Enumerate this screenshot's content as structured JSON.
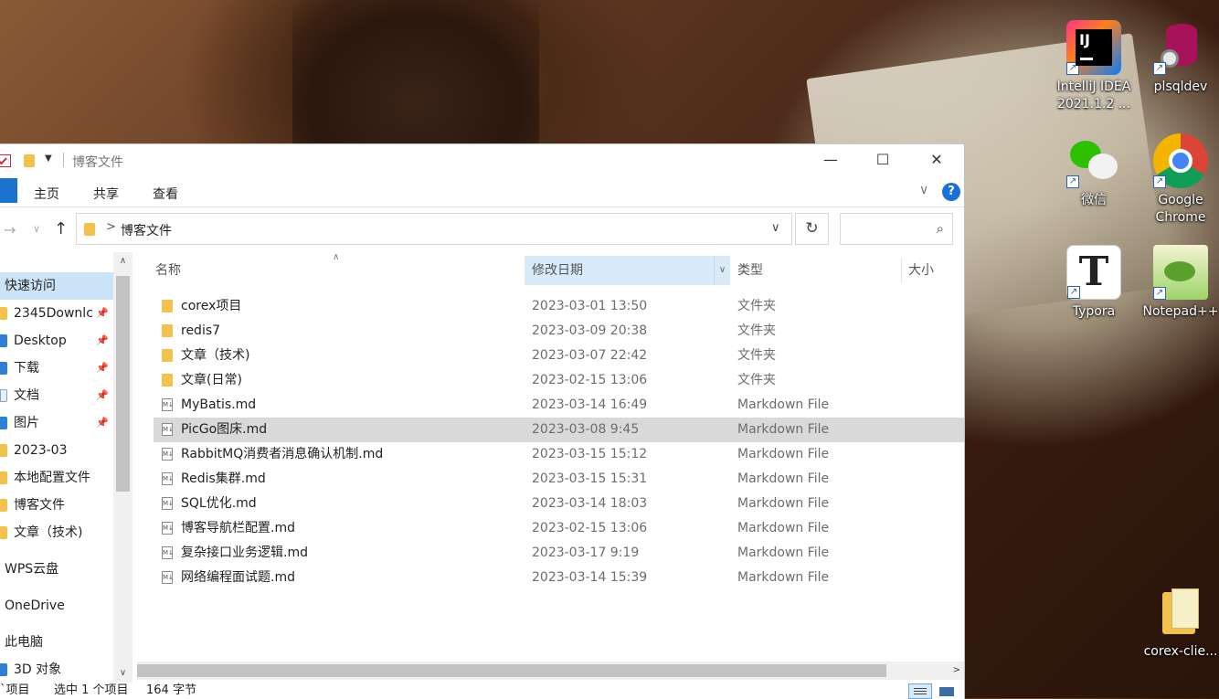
{
  "window": {
    "title": "博客文件",
    "min_glyph": "—",
    "max_glyph": "☐",
    "close_glyph": "✕"
  },
  "ribbon": {
    "tabs": [
      "主页",
      "共享",
      "查看"
    ],
    "help_glyph": "?"
  },
  "address": {
    "path": "博客文件",
    "separator": ">"
  },
  "search": {
    "placeholder": ""
  },
  "navigation": {
    "items": [
      {
        "label": "快速访问",
        "selected": true,
        "pinned": false,
        "icon": "star-icon"
      },
      {
        "label": "2345Downlc",
        "pinned": true,
        "icon": "folder-icon"
      },
      {
        "label": "Desktop",
        "pinned": true,
        "icon": "desktop-icon"
      },
      {
        "label": "下载",
        "pinned": true,
        "icon": "download-icon"
      },
      {
        "label": "文档",
        "pinned": true,
        "icon": "document-icon"
      },
      {
        "label": "图片",
        "pinned": true,
        "icon": "picture-icon"
      },
      {
        "label": "2023-03",
        "pinned": false,
        "icon": "folder-icon"
      },
      {
        "label": "本地配置文件",
        "pinned": false,
        "icon": "folder-icon"
      },
      {
        "label": "博客文件",
        "pinned": false,
        "icon": "folder-icon"
      },
      {
        "label": "文章（技术)",
        "pinned": false,
        "icon": "folder-icon"
      },
      {
        "label": "WPS云盘",
        "pinned": false,
        "icon": "cloud-icon"
      },
      {
        "label": "OneDrive",
        "pinned": false,
        "icon": "onedrive-icon"
      },
      {
        "label": "此电脑",
        "pinned": false,
        "icon": "computer-icon"
      },
      {
        "label": "3D 对象",
        "pinned": false,
        "icon": "3d-objects-icon"
      }
    ]
  },
  "columns": {
    "name": "名称",
    "date": "修改日期",
    "type": "类型",
    "size": "大小"
  },
  "files": [
    {
      "name": "corex项目",
      "date": "2023-03-01 13:50",
      "type": "文件夹",
      "kind": "folder"
    },
    {
      "name": "redis7",
      "date": "2023-03-09 20:38",
      "type": "文件夹",
      "kind": "folder"
    },
    {
      "name": "文章（技术)",
      "date": "2023-03-07 22:42",
      "type": "文件夹",
      "kind": "folder"
    },
    {
      "name": "文章(日常)",
      "date": "2023-02-15 13:06",
      "type": "文件夹",
      "kind": "folder"
    },
    {
      "name": "MyBatis.md",
      "date": "2023-03-14 16:49",
      "type": "Markdown File",
      "kind": "md"
    },
    {
      "name": "PicGo图床.md",
      "date": "2023-03-08 9:45",
      "type": "Markdown File",
      "kind": "md",
      "selected": true
    },
    {
      "name": "RabbitMQ消费者消息确认机制.md",
      "date": "2023-03-15 15:12",
      "type": "Markdown File",
      "kind": "md"
    },
    {
      "name": "Redis集群.md",
      "date": "2023-03-15 15:31",
      "type": "Markdown File",
      "kind": "md"
    },
    {
      "name": "SQL优化.md",
      "date": "2023-03-14 18:03",
      "type": "Markdown File",
      "kind": "md"
    },
    {
      "name": "博客导航栏配置.md",
      "date": "2023-02-15 13:06",
      "type": "Markdown File",
      "kind": "md"
    },
    {
      "name": "复杂接口业务逻辑.md",
      "date": "2023-03-17 9:19",
      "type": "Markdown File",
      "kind": "md"
    },
    {
      "name": "网络编程面试题.md",
      "date": "2023-03-14 15:39",
      "type": "Markdown File",
      "kind": "md"
    }
  ],
  "status": {
    "count": "`项目",
    "selection": "选中 1 个项目",
    "size": "164 字节"
  },
  "desktop_icons": [
    {
      "label": "IntelliJ IDEA 2021.1.2 ...",
      "icon": "intellij-idea-icon"
    },
    {
      "label": "plsqldev",
      "icon": "plsqldev-icon"
    },
    {
      "label": "微信",
      "icon": "wechat-icon"
    },
    {
      "label": "Google Chrome",
      "icon": "chrome-icon"
    },
    {
      "label": "Typora",
      "icon": "typora-icon"
    },
    {
      "label": "Notepad++",
      "icon": "notepad-plus-plus-icon"
    },
    {
      "label": "corex-clie...",
      "icon": "zip-folder-icon"
    }
  ],
  "colors": {
    "selection_nav": "#cce4f7",
    "selection_row": "#d9d9d9",
    "header_sorted": "#d9ebf9",
    "file_tab": "#1a73cf",
    "folder": "#f3c24d"
  }
}
